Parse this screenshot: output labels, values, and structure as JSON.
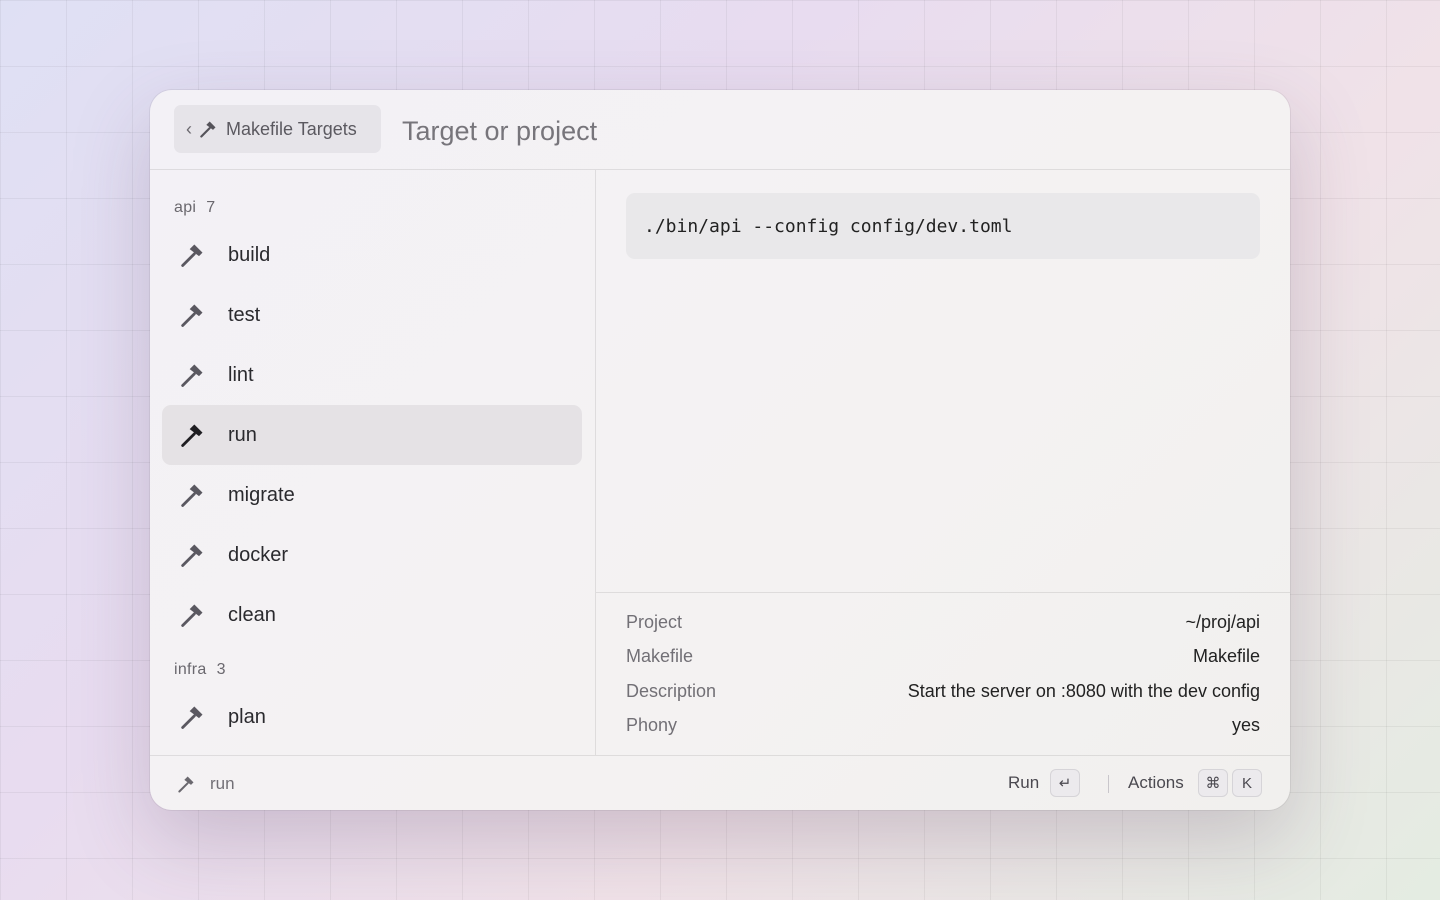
{
  "header": {
    "back_chevron": "‹",
    "back_label": "Makefile Targets",
    "search_placeholder": "Target or project"
  },
  "sections": [
    {
      "name": "api",
      "count": "7",
      "items": [
        {
          "label": "build",
          "icon": "hammer-icon"
        },
        {
          "label": "test",
          "icon": "hammer-icon"
        },
        {
          "label": "lint",
          "icon": "hammer-icon"
        },
        {
          "label": "run",
          "icon": "hammer-icon",
          "selected": true
        },
        {
          "label": "migrate",
          "icon": "hammer-icon"
        },
        {
          "label": "docker",
          "icon": "hammer-icon"
        },
        {
          "label": "clean",
          "icon": "hammer-icon"
        }
      ]
    },
    {
      "name": "infra",
      "count": "3",
      "items": [
        {
          "label": "plan",
          "icon": "hammer-icon"
        }
      ]
    }
  ],
  "detail": {
    "command": "./bin/api --config config/dev.toml",
    "metadata": [
      {
        "key": "Project",
        "value": "~/proj/api"
      },
      {
        "key": "Makefile",
        "value": "Makefile"
      },
      {
        "key": "Description",
        "value": "Start the server on :8080 with the dev config"
      },
      {
        "key": "Phony",
        "value": "yes"
      }
    ]
  },
  "footer": {
    "selected_title": "run",
    "primary_action": "Run",
    "primary_key": "↵",
    "actions_label": "Actions",
    "actions_keys": [
      "⌘",
      "K"
    ]
  },
  "colors": {
    "selection_bg": "#e5e2e5",
    "text_primary": "#2a2a2e",
    "text_secondary": "#727076"
  }
}
